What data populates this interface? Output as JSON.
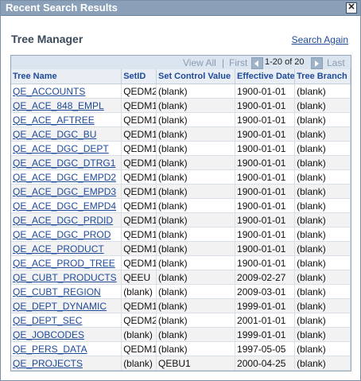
{
  "window": {
    "title": "Recent Search Results"
  },
  "page": {
    "title": "Tree Manager",
    "search_again": "Search Again"
  },
  "nav": {
    "view_all": "View All",
    "separator": "|",
    "first": "First",
    "range": "1-20 of 20",
    "last": "Last"
  },
  "columns": [
    "Tree Name",
    "SetID",
    "Set Control Value",
    "Effective Date",
    "Tree Branch"
  ],
  "rows": [
    [
      "QE_ACCOUNTS",
      "QEDM2",
      "(blank)",
      "1900-01-01",
      "(blank)"
    ],
    [
      "QE_ACE_848_EMPL",
      "QEDM1",
      "(blank)",
      "1900-01-01",
      "(blank)"
    ],
    [
      "QE_ACE_AFTREE",
      "QEDM1",
      "(blank)",
      "1900-01-01",
      "(blank)"
    ],
    [
      "QE_ACE_DGC_BU",
      "QEDM1",
      "(blank)",
      "1900-01-01",
      "(blank)"
    ],
    [
      "QE_ACE_DGC_DEPT",
      "QEDM1",
      "(blank)",
      "1900-01-01",
      "(blank)"
    ],
    [
      "QE_ACE_DGC_DTRG1",
      "QEDM1",
      "(blank)",
      "1900-01-01",
      "(blank)"
    ],
    [
      "QE_ACE_DGC_EMPD2",
      "QEDM1",
      "(blank)",
      "1900-01-01",
      "(blank)"
    ],
    [
      "QE_ACE_DGC_EMPD3",
      "QEDM1",
      "(blank)",
      "1900-01-01",
      "(blank)"
    ],
    [
      "QE_ACE_DGC_EMPD4",
      "QEDM1",
      "(blank)",
      "1900-01-01",
      "(blank)"
    ],
    [
      "QE_ACE_DGC_PRDID",
      "QEDM1",
      "(blank)",
      "1900-01-01",
      "(blank)"
    ],
    [
      "QE_ACE_DGC_PROD",
      "QEDM1",
      "(blank)",
      "1900-01-01",
      "(blank)"
    ],
    [
      "QE_ACE_PRODUCT",
      "QEDM1",
      "(blank)",
      "1900-01-01",
      "(blank)"
    ],
    [
      "QE_ACE_PROD_TREE",
      "QEDM1",
      "(blank)",
      "1900-01-01",
      "(blank)"
    ],
    [
      "QE_CUBT_PRODUCTS",
      "QEEU",
      "(blank)",
      "2009-02-27",
      "(blank)"
    ],
    [
      "QE_CUBT_REGION",
      "(blank)",
      "(blank)",
      "2009-03-01",
      "(blank)"
    ],
    [
      "QE_DEPT_DYNAMIC",
      "QEDM1",
      "(blank)",
      "1999-01-01",
      "(blank)"
    ],
    [
      "QE_DEPT_SEC",
      "QEDM2",
      "(blank)",
      "2001-01-01",
      "(blank)"
    ],
    [
      "QE_JOBCODES",
      "(blank)",
      "(blank)",
      "1999-01-01",
      "(blank)"
    ],
    [
      "QE_PERS_DATA",
      "QEDM1",
      "(blank)",
      "1997-05-05",
      "(blank)"
    ],
    [
      "QE_PROJECTS",
      "(blank)",
      "QEBU1",
      "2000-04-25",
      "(blank)"
    ]
  ]
}
